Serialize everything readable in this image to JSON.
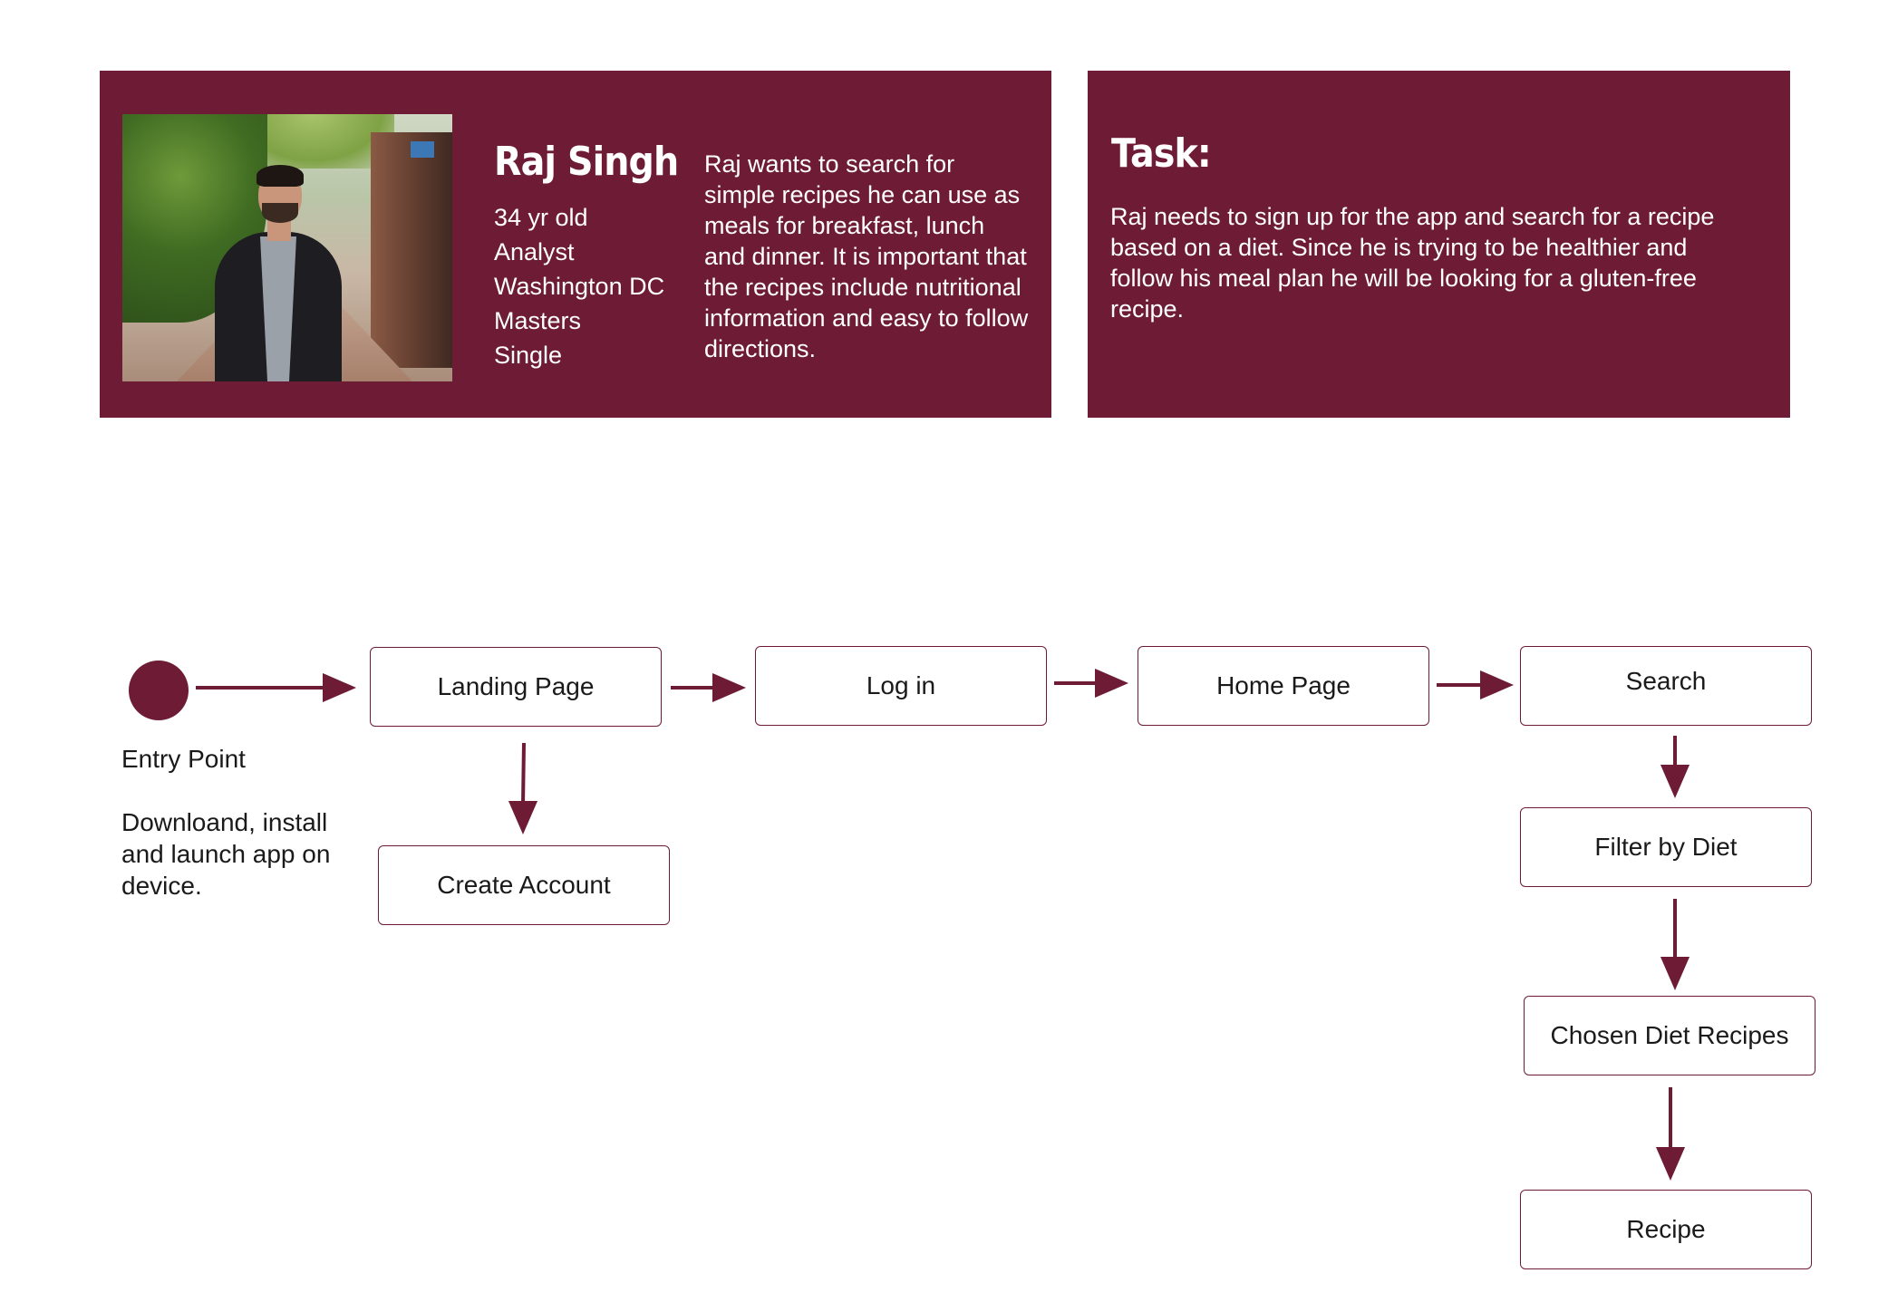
{
  "colors": {
    "accent": "#6e1b36",
    "node_border": "#6e1b36",
    "text": "#1a1a1a",
    "background": "#ffffff"
  },
  "persona": {
    "photo_icon": "persona-photo",
    "name": "Raj Singh",
    "facts": [
      "34 yr old",
      "Analyst",
      "Washington DC",
      "Masters",
      "Single"
    ],
    "description": "Raj wants to search for simple recipes he can use as meals for breakfast, lunch and dinner. It is important that the recipes include nutritional information and easy to follow directions."
  },
  "task": {
    "title": "Task:",
    "description": "Raj needs to sign up for the app and search for a recipe based on a diet. Since he is trying to be healthier and follow his meal plan he will be looking for a gluten-free recipe."
  },
  "flow": {
    "entry": {
      "label": "Entry Point",
      "note": "Downloand, install and launch app on device."
    },
    "nodes": {
      "landing": "Landing Page",
      "login": "Log in",
      "home": "Home Page",
      "search": "Search",
      "create_account": "Create Account",
      "filter": "Filter by Diet",
      "chosen": "Chosen Diet Recipes",
      "recipe": "Recipe"
    }
  }
}
